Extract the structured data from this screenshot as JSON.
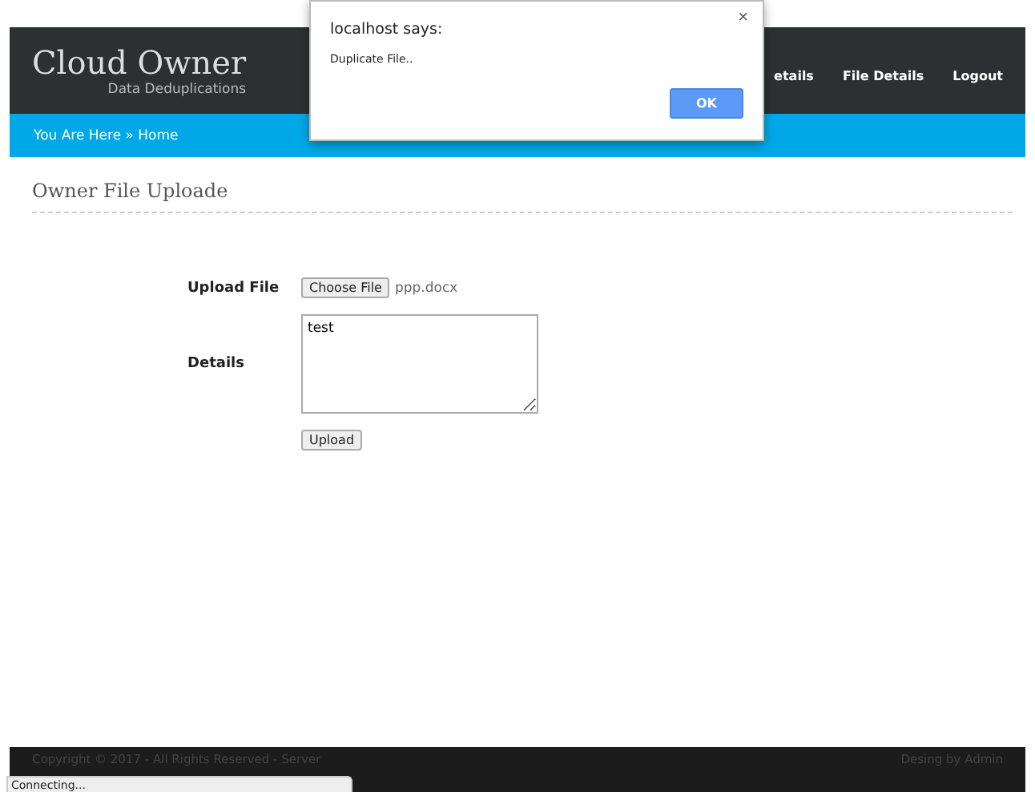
{
  "header": {
    "title": "Cloud Owner",
    "subtitle": "Data Deduplications",
    "nav": [
      {
        "label": "etails"
      },
      {
        "label": "File Details"
      },
      {
        "label": "Logout"
      }
    ]
  },
  "breadcrumb": {
    "text": "You Are Here » Home"
  },
  "page_title": "Owner File Uploade",
  "form": {
    "file_label": "Upload File",
    "choose_button": "Choose File",
    "file_name": "ppp.docx",
    "details_label": "Details",
    "details_value": "test",
    "submit": "Upload"
  },
  "dialog": {
    "title": "localhost says:",
    "message": "Duplicate File..",
    "close": "×",
    "ok": "OK"
  },
  "footer": {
    "left": "Copyright © 2017 - All Rights Reserved - Server",
    "right": "Desing by Admin"
  },
  "status": "Connecting..."
}
